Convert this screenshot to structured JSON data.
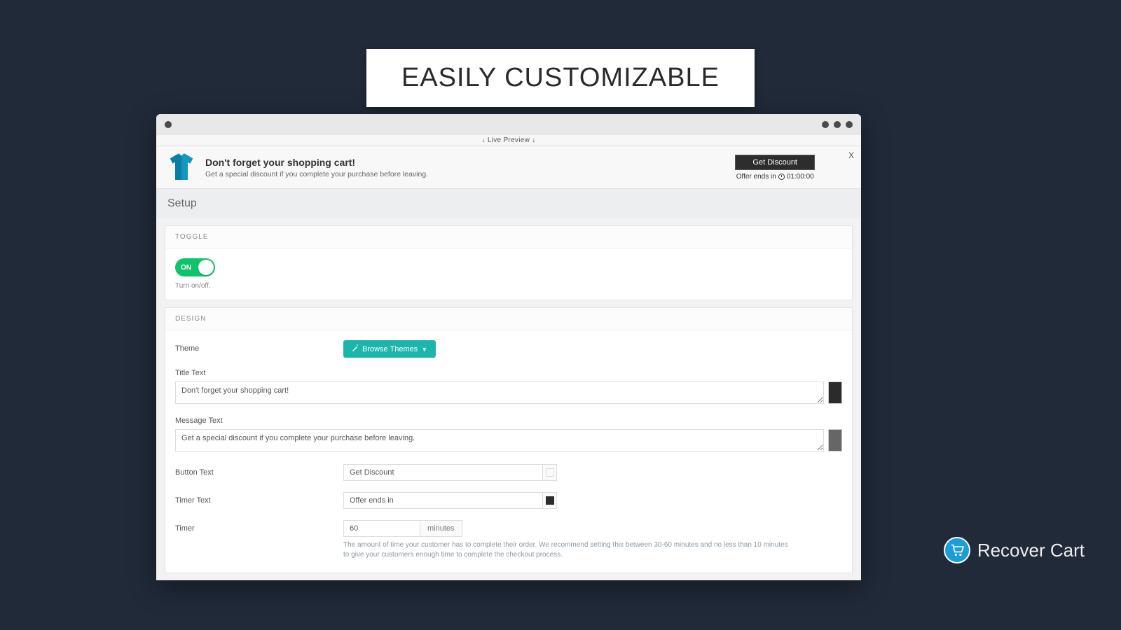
{
  "headline": "Easily customizable",
  "live_preview_label": "Live Preview",
  "preview": {
    "title": "Don't forget your shopping cart!",
    "subtitle": "Get a special discount if you complete your purchase before leaving.",
    "button": "Get Discount",
    "timer_prefix": "Offer ends in",
    "timer_value": "01:00:00",
    "close": "X"
  },
  "setup_heading": "Setup",
  "toggle": {
    "section_title": "TOGGLE",
    "state": "ON",
    "help": "Turn on/off."
  },
  "design": {
    "section_title": "DESIGN",
    "theme_label": "Theme",
    "browse_label": "Browse Themes",
    "title_text_label": "Title Text",
    "title_text_value": "Don't forget your shopping cart!",
    "title_text_color": "#2b2b2b",
    "message_text_label": "Message Text",
    "message_text_value": "Get a special discount if you complete your purchase before leaving.",
    "message_text_color": "#666666",
    "button_text_label": "Button Text",
    "button_text_value": "Get Discount",
    "button_text_color": "#fafafa",
    "timer_text_label": "Timer Text",
    "timer_text_value": "Offer ends in",
    "timer_text_color": "#2b2b2b",
    "timer_label": "Timer",
    "timer_value": "60",
    "timer_unit": "minutes",
    "timer_help": "The amount of time your customer has to complete their order. We recommend setting this between 30-60 minutes and no less than 10 minutes to give your customers enough time to complete the checkout process."
  },
  "brand": {
    "name_light": "Recover",
    "name_bold": "Cart"
  }
}
